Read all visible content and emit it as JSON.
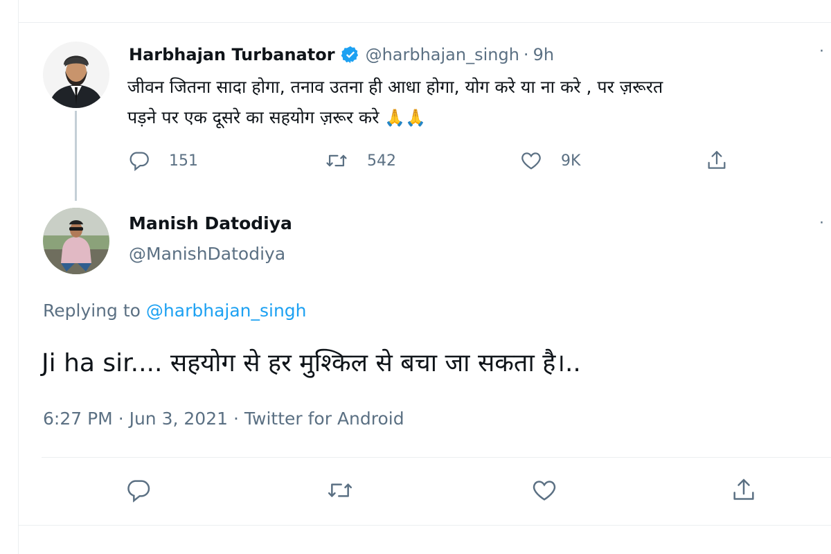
{
  "original_tweet": {
    "display_name": "Harbhajan Turbanator",
    "verified": true,
    "handle": "@harbhajan_singh",
    "age": "9h",
    "text_line1": "जीवन जितना सादा होगा, तनाव उतना ही आधा होगा, योग करे या ना करे , पर ज़रूरत",
    "text_line2": "पड़ने पर एक दूसरे का सहयोग ज़रूर करे",
    "emoji": "🙏🙏",
    "reply_count": "151",
    "retweet_count": "542",
    "like_count": "9K",
    "icons": [
      "reply-icon",
      "retweet-icon",
      "like-icon",
      "share-icon",
      "more-icon"
    ]
  },
  "reply_tweet": {
    "display_name": "Manish Datodiya",
    "handle": "@ManishDatodiya",
    "replying_prefix": "Replying to",
    "replying_mention": "@harbhajan_singh",
    "text": "Ji ha sir.... सहयोग से हर मुश्किल से बचा जा सकता है।..",
    "time": "6:27 PM",
    "date": "Jun 3, 2021",
    "source": "Twitter for Android"
  },
  "separator": "·",
  "colors": {
    "accent": "#1da1f2",
    "secondary_text": "#5b7083",
    "primary_text": "#0f1419",
    "divider": "#ebeef0"
  }
}
